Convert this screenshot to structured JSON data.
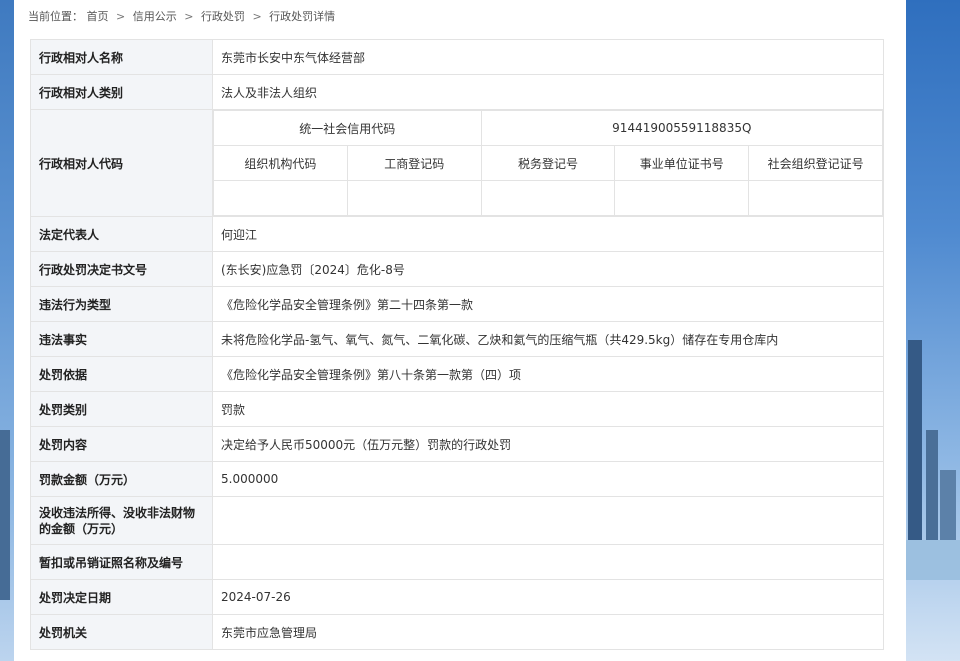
{
  "breadcrumb": {
    "prefix": "当前位置：",
    "items": [
      "首页",
      "信用公示",
      "行政处罚",
      "行政处罚详情"
    ],
    "separator": ">"
  },
  "detail": {
    "name_label": "行政相对人名称",
    "name_value": "东莞市长安中东气体经营部",
    "category_label": "行政相对人类别",
    "category_value": "法人及非法人组织",
    "code_label": "行政相对人代码",
    "codes": {
      "uscc_label": "统一社会信用代码",
      "uscc_value": "91441900559118835Q",
      "headers": [
        "组织机构代码",
        "工商登记码",
        "税务登记号",
        "事业单位证书号",
        "社会组织登记证号"
      ],
      "values": [
        "",
        "",
        "",
        "",
        ""
      ]
    },
    "legal_rep_label": "法定代表人",
    "legal_rep_value": "何迎江",
    "doc_no_label": "行政处罚决定书文号",
    "doc_no_value": "(东长安)应急罚〔2024〕危化-8号",
    "violation_type_label": "违法行为类型",
    "violation_type_value": "《危险化学品安全管理条例》第二十四条第一款",
    "facts_label": "违法事实",
    "facts_value": "未将危险化学品-氢气、氧气、氮气、二氧化碳、乙炔和氦气的压缩气瓶（共429.5kg）储存在专用仓库内",
    "basis_label": "处罚依据",
    "basis_value": "《危险化学品安全管理条例》第八十条第一款第（四）项",
    "penalty_type_label": "处罚类别",
    "penalty_type_value": "罚款",
    "penalty_content_label": "处罚内容",
    "penalty_content_value": "决定给予人民币50000元（伍万元整）罚款的行政处罚",
    "fine_label": "罚款金额（万元）",
    "fine_value": "5.000000",
    "confiscation_label": "没收违法所得、没收非法财物的金额（万元）",
    "confiscation_value": "",
    "license_label": "暂扣或吊销证照名称及编号",
    "license_value": "",
    "date_label": "处罚决定日期",
    "date_value": "2024-07-26",
    "authority_label": "处罚机关",
    "authority_value": "东莞市应急管理局"
  }
}
